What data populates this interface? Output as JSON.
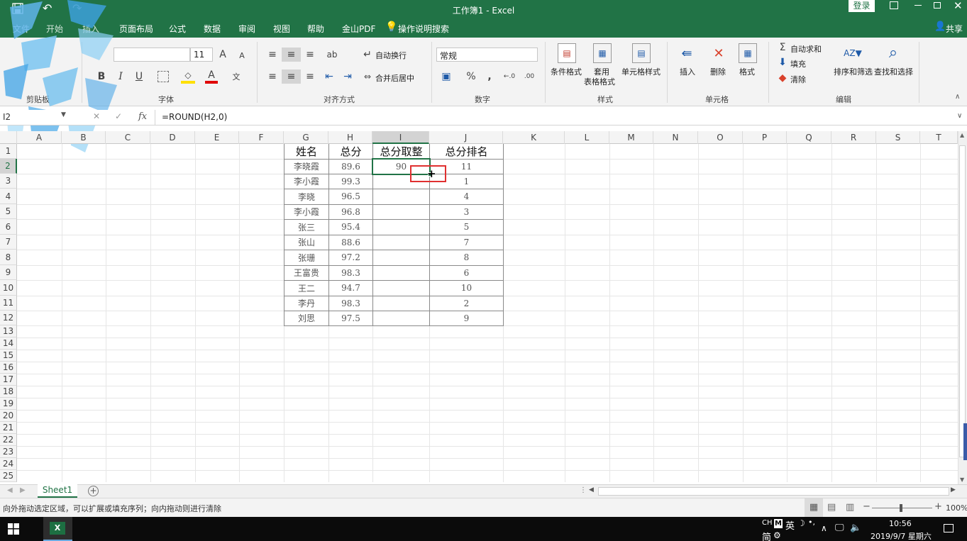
{
  "titlebar": {
    "title": "工作簿1 - Excel",
    "login": "登录"
  },
  "tabs": [
    "文件",
    "开始",
    "插入",
    "页面布局",
    "公式",
    "数据",
    "审阅",
    "视图",
    "帮助",
    "金山PDF"
  ],
  "tell_me": "操作说明搜索",
  "share": "共享",
  "ribbon": {
    "font_size": "11",
    "wrap_text": "自动换行",
    "merge_center": "合并后居中",
    "number_format": "常规",
    "cond_format": "条件格式",
    "table_format_1": "套用",
    "table_format_2": "表格格式",
    "cell_styles": "单元格样式",
    "insert": "插入",
    "delete": "删除",
    "format": "格式",
    "autosum": "自动求和",
    "fill": "填充",
    "clear": "清除",
    "sort_filter": "排序和筛选",
    "find_select": "查找和选择",
    "groups": {
      "clipboard": "剪贴板",
      "font": "字体",
      "alignment": "对齐方式",
      "number": "数字",
      "styles": "样式",
      "cells": "单元格",
      "editing": "编辑"
    }
  },
  "formula_bar": {
    "name_box": "I2",
    "fx": "fx",
    "formula": "=ROUND(H2,0)"
  },
  "columns": [
    "A",
    "B",
    "C",
    "D",
    "E",
    "F",
    "G",
    "H",
    "I",
    "J",
    "K",
    "L",
    "M",
    "N",
    "O",
    "P",
    "Q",
    "R",
    "S",
    "T"
  ],
  "rows": [
    "1",
    "2",
    "3",
    "4",
    "5",
    "6",
    "7",
    "8",
    "9",
    "10",
    "11",
    "12",
    "13",
    "14",
    "15",
    "16",
    "17",
    "18",
    "19",
    "20",
    "21",
    "22",
    "23",
    "24",
    "25"
  ],
  "table": {
    "headers": [
      "姓名",
      "总分",
      "总分取整",
      "总分排名"
    ],
    "rows": [
      [
        "李晓霞",
        "89.6",
        "90",
        "11"
      ],
      [
        "李小霞",
        "99.3",
        "",
        "1"
      ],
      [
        "李晓",
        "96.5",
        "",
        "4"
      ],
      [
        "李小霞",
        "96.8",
        "",
        "3"
      ],
      [
        "张三",
        "95.4",
        "",
        "5"
      ],
      [
        "张山",
        "88.6",
        "",
        "7"
      ],
      [
        "张珊",
        "97.2",
        "",
        "8"
      ],
      [
        "王富贵",
        "98.3",
        "",
        "6"
      ],
      [
        "王二",
        "94.7",
        "",
        "10"
      ],
      [
        "李丹",
        "98.3",
        "",
        "2"
      ],
      [
        "刘思",
        "97.5",
        "",
        "9"
      ]
    ]
  },
  "sheet_tab": "Sheet1",
  "status": {
    "message": "向外拖动选定区域，可以扩展或填充序列；向内拖动则进行清除",
    "zoom": "100%"
  },
  "taskbar": {
    "ime": "CH",
    "ime_mode": "英",
    "ime_mode2": "简",
    "time": "10:56",
    "date": "2019/9/7 星期六"
  },
  "colors": {
    "excel_green": "#217346",
    "fill_handle_highlight": "#e03030"
  }
}
